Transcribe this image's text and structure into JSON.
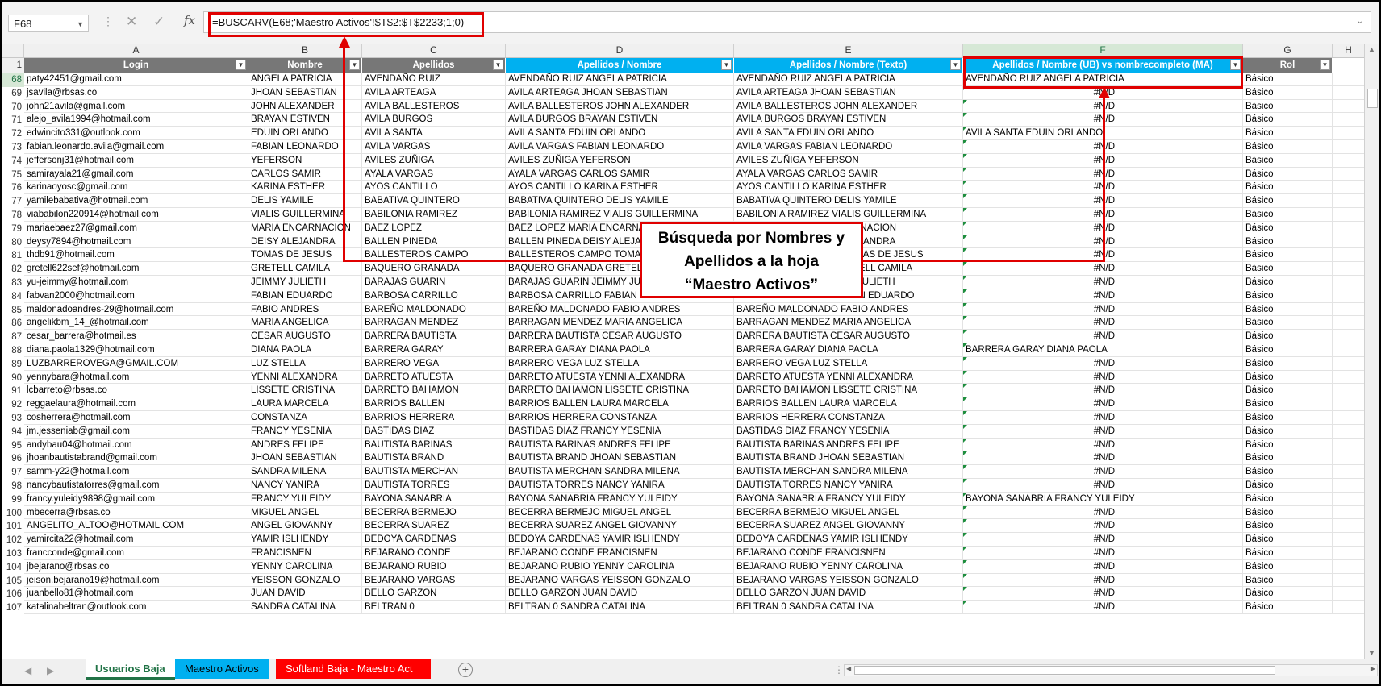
{
  "formula_bar": {
    "name_box": "F68",
    "fx": "fx",
    "formula": "=BUSCARV(E68;'Maestro Activos'!$T$2:$T$2233;1;0)"
  },
  "columns": [
    "A",
    "B",
    "C",
    "D",
    "E",
    "F",
    "G",
    "H"
  ],
  "header_row_number": "1",
  "headers": [
    "Login",
    "Nombre",
    "Apellidos",
    "Apellidos / Nombre",
    "Apellidos / Nombre (Texto)",
    "Apellidos / Nombre (UB) vs nombrecompleto (MA)",
    "Rol"
  ],
  "rows": [
    {
      "n": "68",
      "login": "paty42451@gmail.com",
      "nombre": "ANGELA PATRICIA",
      "apellidos": "AVENDAÑO RUIZ",
      "ap_nom": "AVENDAÑO RUIZ ANGELA PATRICIA",
      "ap_nom_txt": "AVENDAÑO RUIZ ANGELA PATRICIA",
      "vs": "AVENDAÑO RUIZ ANGELA PATRICIA",
      "rol": "Básico"
    },
    {
      "n": "69",
      "login": "jsavila@rbsas.co",
      "nombre": "JHOAN SEBASTIAN",
      "apellidos": "AVILA ARTEAGA",
      "ap_nom": "AVILA ARTEAGA JHOAN SEBASTIAN",
      "ap_nom_txt": "AVILA ARTEAGA JHOAN SEBASTIAN",
      "vs": "#N/D",
      "rol": "Básico"
    },
    {
      "n": "70",
      "login": "john21avila@gmail.com",
      "nombre": "JOHN ALEXANDER",
      "apellidos": "AVILA BALLESTEROS",
      "ap_nom": "AVILA BALLESTEROS JOHN ALEXANDER",
      "ap_nom_txt": "AVILA BALLESTEROS JOHN ALEXANDER",
      "vs": "#N/D",
      "rol": "Básico"
    },
    {
      "n": "71",
      "login": "alejo_avila1994@hotmail.com",
      "nombre": "BRAYAN ESTIVEN",
      "apellidos": "AVILA BURGOS",
      "ap_nom": "AVILA BURGOS BRAYAN ESTIVEN",
      "ap_nom_txt": "AVILA BURGOS BRAYAN ESTIVEN",
      "vs": "#N/D",
      "rol": "Básico"
    },
    {
      "n": "72",
      "login": "edwincito331@outlook.com",
      "nombre": "EDUIN ORLANDO",
      "apellidos": "AVILA SANTA",
      "ap_nom": "AVILA SANTA EDUIN ORLANDO",
      "ap_nom_txt": "AVILA SANTA EDUIN ORLANDO",
      "vs": "AVILA SANTA EDUIN ORLANDO",
      "rol": "Básico"
    },
    {
      "n": "73",
      "login": "fabian.leonardo.avila@gmail.com",
      "nombre": "FABIAN LEONARDO",
      "apellidos": "AVILA VARGAS",
      "ap_nom": "AVILA VARGAS FABIAN LEONARDO",
      "ap_nom_txt": "AVILA VARGAS FABIAN LEONARDO",
      "vs": "#N/D",
      "rol": "Básico"
    },
    {
      "n": "74",
      "login": "jeffersonj31@hotmail.com",
      "nombre": "YEFERSON",
      "apellidos": "AVILES ZUÑIGA",
      "ap_nom": "AVILES ZUÑIGA YEFERSON",
      "ap_nom_txt": "AVILES ZUÑIGA YEFERSON",
      "vs": "#N/D",
      "rol": "Básico"
    },
    {
      "n": "75",
      "login": "samirayala21@gmail.com",
      "nombre": "CARLOS SAMIR",
      "apellidos": "AYALA VARGAS",
      "ap_nom": "AYALA VARGAS CARLOS SAMIR",
      "ap_nom_txt": "AYALA VARGAS CARLOS SAMIR",
      "vs": "#N/D",
      "rol": "Básico"
    },
    {
      "n": "76",
      "login": "karinaoyosc@gmail.com",
      "nombre": "KARINA  ESTHER",
      "apellidos": "AYOS CANTILLO",
      "ap_nom": "AYOS CANTILLO KARINA  ESTHER",
      "ap_nom_txt": "AYOS CANTILLO KARINA  ESTHER",
      "vs": "#N/D",
      "rol": "Básico"
    },
    {
      "n": "77",
      "login": "yamilebabativa@hotmail.com",
      "nombre": "DELIS YAMILE",
      "apellidos": "BABATIVA QUINTERO",
      "ap_nom": "BABATIVA QUINTERO DELIS YAMILE",
      "ap_nom_txt": "BABATIVA QUINTERO DELIS YAMILE",
      "vs": "#N/D",
      "rol": "Básico"
    },
    {
      "n": "78",
      "login": "viababilon220914@hotmail.com",
      "nombre": "VIALIS GUILLERMINA",
      "apellidos": "BABILONIA RAMIREZ",
      "ap_nom": "BABILONIA RAMIREZ VIALIS GUILLERMINA",
      "ap_nom_txt": "BABILONIA RAMIREZ VIALIS GUILLERMINA",
      "vs": "#N/D",
      "rol": "Básico"
    },
    {
      "n": "79",
      "login": "mariaebaez27@gmail.com",
      "nombre": "MARIA ENCARNACION",
      "apellidos": "BAEZ LOPEZ",
      "ap_nom": "BAEZ LOPEZ MARIA ENCARNACION",
      "ap_nom_txt": "BAEZ LOPEZ MARIA ENCARNACION",
      "vs": "#N/D",
      "rol": "Básico"
    },
    {
      "n": "80",
      "login": "deysy7894@hotmail.com",
      "nombre": "DEISY ALEJANDRA",
      "apellidos": "BALLEN PINEDA",
      "ap_nom": "BALLEN PINEDA DEISY ALEJANDRA",
      "ap_nom_txt": "BALLEN PINEDA DEISY ALEJANDRA",
      "vs": "#N/D",
      "rol": "Básico"
    },
    {
      "n": "81",
      "login": "thdb91@hotmail.com",
      "nombre": "TOMAS DE JESUS",
      "apellidos": "BALLESTEROS CAMPO",
      "ap_nom": "BALLESTEROS CAMPO TOMAS DE JESUS",
      "ap_nom_txt": "BALLESTEROS CAMPO TOMAS DE JESUS",
      "vs": "#N/D",
      "rol": "Básico"
    },
    {
      "n": "82",
      "login": "gretell622sef@hotmail.com",
      "nombre": "GRETELL CAMILA",
      "apellidos": "BAQUERO GRANADA",
      "ap_nom": "BAQUERO GRANADA GRETELL CAMILA",
      "ap_nom_txt": "BAQUERO GRANADA GRETELL CAMILA",
      "vs": "#N/D",
      "rol": "Básico"
    },
    {
      "n": "83",
      "login": "yu-jeimmy@hotmail.com",
      "nombre": "JEIMMY JULIETH",
      "apellidos": "BARAJAS GUARIN",
      "ap_nom": "BARAJAS GUARIN JEIMMY JULIETH",
      "ap_nom_txt": "BARAJAS GUARIN JEIMMY JULIETH",
      "vs": "#N/D",
      "rol": "Básico"
    },
    {
      "n": "84",
      "login": "fabvan2000@hotmail.com",
      "nombre": "FABIAN EDUARDO",
      "apellidos": "BARBOSA CARRILLO",
      "ap_nom": "BARBOSA CARRILLO FABIAN EDUARDO",
      "ap_nom_txt": "BARBOSA CARRILLO FABIAN EDUARDO",
      "vs": "#N/D",
      "rol": "Básico"
    },
    {
      "n": "85",
      "login": "maldonadoandres-29@hotmail.com",
      "nombre": "FABIO ANDRES",
      "apellidos": "BAREÑO MALDONADO",
      "ap_nom": "BAREÑO MALDONADO FABIO ANDRES",
      "ap_nom_txt": "BAREÑO MALDONADO FABIO ANDRES",
      "vs": "#N/D",
      "rol": "Básico"
    },
    {
      "n": "86",
      "login": "angelikbm_14_@hotmail.com",
      "nombre": "MARIA ANGELICA",
      "apellidos": "BARRAGAN MENDEZ",
      "ap_nom": "BARRAGAN MENDEZ MARIA ANGELICA",
      "ap_nom_txt": "BARRAGAN MENDEZ MARIA ANGELICA",
      "vs": "#N/D",
      "rol": "Básico"
    },
    {
      "n": "87",
      "login": "cesar_barrera@hotmail.es",
      "nombre": "CESAR AUGUSTO",
      "apellidos": "BARRERA BAUTISTA",
      "ap_nom": "BARRERA BAUTISTA CESAR AUGUSTO",
      "ap_nom_txt": "BARRERA BAUTISTA CESAR AUGUSTO",
      "vs": "#N/D",
      "rol": "Básico"
    },
    {
      "n": "88",
      "login": "diana.paola1329@hotmail.com",
      "nombre": "DIANA PAOLA",
      "apellidos": "BARRERA GARAY",
      "ap_nom": "BARRERA GARAY DIANA PAOLA",
      "ap_nom_txt": "BARRERA GARAY DIANA PAOLA",
      "vs": "BARRERA GARAY DIANA PAOLA",
      "rol": "Básico"
    },
    {
      "n": "89",
      "login": "LUZBARREROVEGA@GMAIL.COM",
      "nombre": "LUZ STELLA",
      "apellidos": "BARRERO VEGA",
      "ap_nom": "BARRERO VEGA LUZ STELLA",
      "ap_nom_txt": "BARRERO VEGA LUZ STELLA",
      "vs": "#N/D",
      "rol": "Básico"
    },
    {
      "n": "90",
      "login": "yennybara@hotmail.com",
      "nombre": "YENNI  ALEXANDRA",
      "apellidos": "BARRETO ATUESTA",
      "ap_nom": "BARRETO ATUESTA YENNI  ALEXANDRA",
      "ap_nom_txt": "BARRETO ATUESTA YENNI  ALEXANDRA",
      "vs": "#N/D",
      "rol": "Básico"
    },
    {
      "n": "91",
      "login": "lcbarreto@rbsas.co",
      "nombre": "LISSETE CRISTINA",
      "apellidos": "BARRETO BAHAMON",
      "ap_nom": "BARRETO BAHAMON LISSETE CRISTINA",
      "ap_nom_txt": "BARRETO BAHAMON LISSETE CRISTINA",
      "vs": "#N/D",
      "rol": "Básico"
    },
    {
      "n": "92",
      "login": "reggaelaura@hotmail.com",
      "nombre": "LAURA  MARCELA",
      "apellidos": "BARRIOS BALLEN",
      "ap_nom": "BARRIOS BALLEN LAURA  MARCELA",
      "ap_nom_txt": "BARRIOS BALLEN LAURA  MARCELA",
      "vs": "#N/D",
      "rol": "Básico"
    },
    {
      "n": "93",
      "login": "cosherrera@hotmail.com",
      "nombre": "CONSTANZA",
      "apellidos": "BARRIOS HERRERA",
      "ap_nom": "BARRIOS HERRERA CONSTANZA",
      "ap_nom_txt": "BARRIOS HERRERA CONSTANZA",
      "vs": "#N/D",
      "rol": "Básico"
    },
    {
      "n": "94",
      "login": "jm.jesseniab@gmail.com",
      "nombre": "FRANCY YESENIA",
      "apellidos": "BASTIDAS DIAZ",
      "ap_nom": "BASTIDAS DIAZ FRANCY YESENIA",
      "ap_nom_txt": "BASTIDAS DIAZ FRANCY YESENIA",
      "vs": "#N/D",
      "rol": "Básico"
    },
    {
      "n": "95",
      "login": "andybau04@hotmail.com",
      "nombre": "ANDRES FELIPE",
      "apellidos": "BAUTISTA BARINAS",
      "ap_nom": "BAUTISTA BARINAS ANDRES FELIPE",
      "ap_nom_txt": "BAUTISTA BARINAS ANDRES FELIPE",
      "vs": "#N/D",
      "rol": "Básico"
    },
    {
      "n": "96",
      "login": "jhoanbautistabrand@gmail.com",
      "nombre": "JHOAN SEBASTIAN",
      "apellidos": "BAUTISTA BRAND",
      "ap_nom": "BAUTISTA BRAND JHOAN SEBASTIAN",
      "ap_nom_txt": "BAUTISTA BRAND JHOAN SEBASTIAN",
      "vs": "#N/D",
      "rol": "Básico"
    },
    {
      "n": "97",
      "login": "samm-y22@hotmail.com",
      "nombre": "SANDRA MILENA",
      "apellidos": "BAUTISTA MERCHAN",
      "ap_nom": "BAUTISTA MERCHAN SANDRA MILENA",
      "ap_nom_txt": "BAUTISTA MERCHAN SANDRA MILENA",
      "vs": "#N/D",
      "rol": "Básico"
    },
    {
      "n": "98",
      "login": "nancybautistatorres@gmail.com",
      "nombre": "NANCY  YANIRA",
      "apellidos": "BAUTISTA TORRES",
      "ap_nom": "BAUTISTA TORRES NANCY  YANIRA",
      "ap_nom_txt": "BAUTISTA TORRES NANCY  YANIRA",
      "vs": "#N/D",
      "rol": "Básico"
    },
    {
      "n": "99",
      "login": "francy.yuleidy9898@gmail.com",
      "nombre": "FRANCY YULEIDY",
      "apellidos": "BAYONA SANABRIA",
      "ap_nom": "BAYONA SANABRIA FRANCY YULEIDY",
      "ap_nom_txt": "BAYONA SANABRIA FRANCY YULEIDY",
      "vs": "BAYONA SANABRIA FRANCY YULEIDY",
      "rol": "Básico"
    },
    {
      "n": "100",
      "login": "mbecerra@rbsas.co",
      "nombre": "MIGUEL ANGEL",
      "apellidos": "BECERRA BERMEJO",
      "ap_nom": "BECERRA BERMEJO MIGUEL ANGEL",
      "ap_nom_txt": "BECERRA BERMEJO MIGUEL ANGEL",
      "vs": "#N/D",
      "rol": "Básico"
    },
    {
      "n": "101",
      "login": "ANGELITO_ALTOO@HOTMAIL.COM",
      "nombre": "ANGEL GIOVANNY",
      "apellidos": "BECERRA SUAREZ",
      "ap_nom": "BECERRA SUAREZ ANGEL GIOVANNY",
      "ap_nom_txt": "BECERRA SUAREZ ANGEL GIOVANNY",
      "vs": "#N/D",
      "rol": "Básico"
    },
    {
      "n": "102",
      "login": "yamircita22@hotmail.com",
      "nombre": "YAMIR ISLHENDY",
      "apellidos": "BEDOYA CARDENAS",
      "ap_nom": "BEDOYA CARDENAS YAMIR ISLHENDY",
      "ap_nom_txt": "BEDOYA CARDENAS YAMIR ISLHENDY",
      "vs": "#N/D",
      "rol": "Básico"
    },
    {
      "n": "103",
      "login": "francconde@gmail.com",
      "nombre": "FRANCISNEN",
      "apellidos": "BEJARANO CONDE",
      "ap_nom": "BEJARANO CONDE FRANCISNEN",
      "ap_nom_txt": "BEJARANO CONDE FRANCISNEN",
      "vs": "#N/D",
      "rol": "Básico"
    },
    {
      "n": "104",
      "login": "jbejarano@rbsas.co",
      "nombre": "YENNY CAROLINA",
      "apellidos": "BEJARANO RUBIO",
      "ap_nom": "BEJARANO RUBIO YENNY CAROLINA",
      "ap_nom_txt": "BEJARANO RUBIO YENNY CAROLINA",
      "vs": "#N/D",
      "rol": "Básico"
    },
    {
      "n": "105",
      "login": "jeison.bejarano19@hotmail.com",
      "nombre": "YEISSON GONZALO",
      "apellidos": "BEJARANO VARGAS",
      "ap_nom": "BEJARANO VARGAS YEISSON GONZALO",
      "ap_nom_txt": "BEJARANO VARGAS YEISSON GONZALO",
      "vs": "#N/D",
      "rol": "Básico"
    },
    {
      "n": "106",
      "login": "juanbello81@hotmail.com",
      "nombre": "JUAN DAVID",
      "apellidos": "BELLO GARZON",
      "ap_nom": "BELLO GARZON JUAN DAVID",
      "ap_nom_txt": "BELLO GARZON JUAN DAVID",
      "vs": "#N/D",
      "rol": "Básico"
    },
    {
      "n": "107",
      "login": "katalinabeltran@outlook.com",
      "nombre": "SANDRA CATALINA",
      "apellidos": "BELTRAN 0",
      "ap_nom": "BELTRAN 0 SANDRA CATALINA",
      "ap_nom_txt": "BELTRAN 0 SANDRA CATALINA",
      "vs": "#N/D",
      "rol": "Básico"
    }
  ],
  "callout": {
    "line1": "Búsqueda por Nombres y",
    "line2": "Apellidos a la hoja",
    "line3": "“Maestro Activos”"
  },
  "tabs": [
    {
      "label": "Usuarios Baja",
      "state": "active"
    },
    {
      "label": "Maestro Activos",
      "color": "#00b0f0"
    },
    {
      "label": "Softland Baja - Maestro Act",
      "color": "#ff0000"
    }
  ],
  "colors": {
    "excel_green": "#217346",
    "header_gray": "#777777",
    "header_blue": "#00b0f0",
    "annotation_red": "#e00000"
  }
}
